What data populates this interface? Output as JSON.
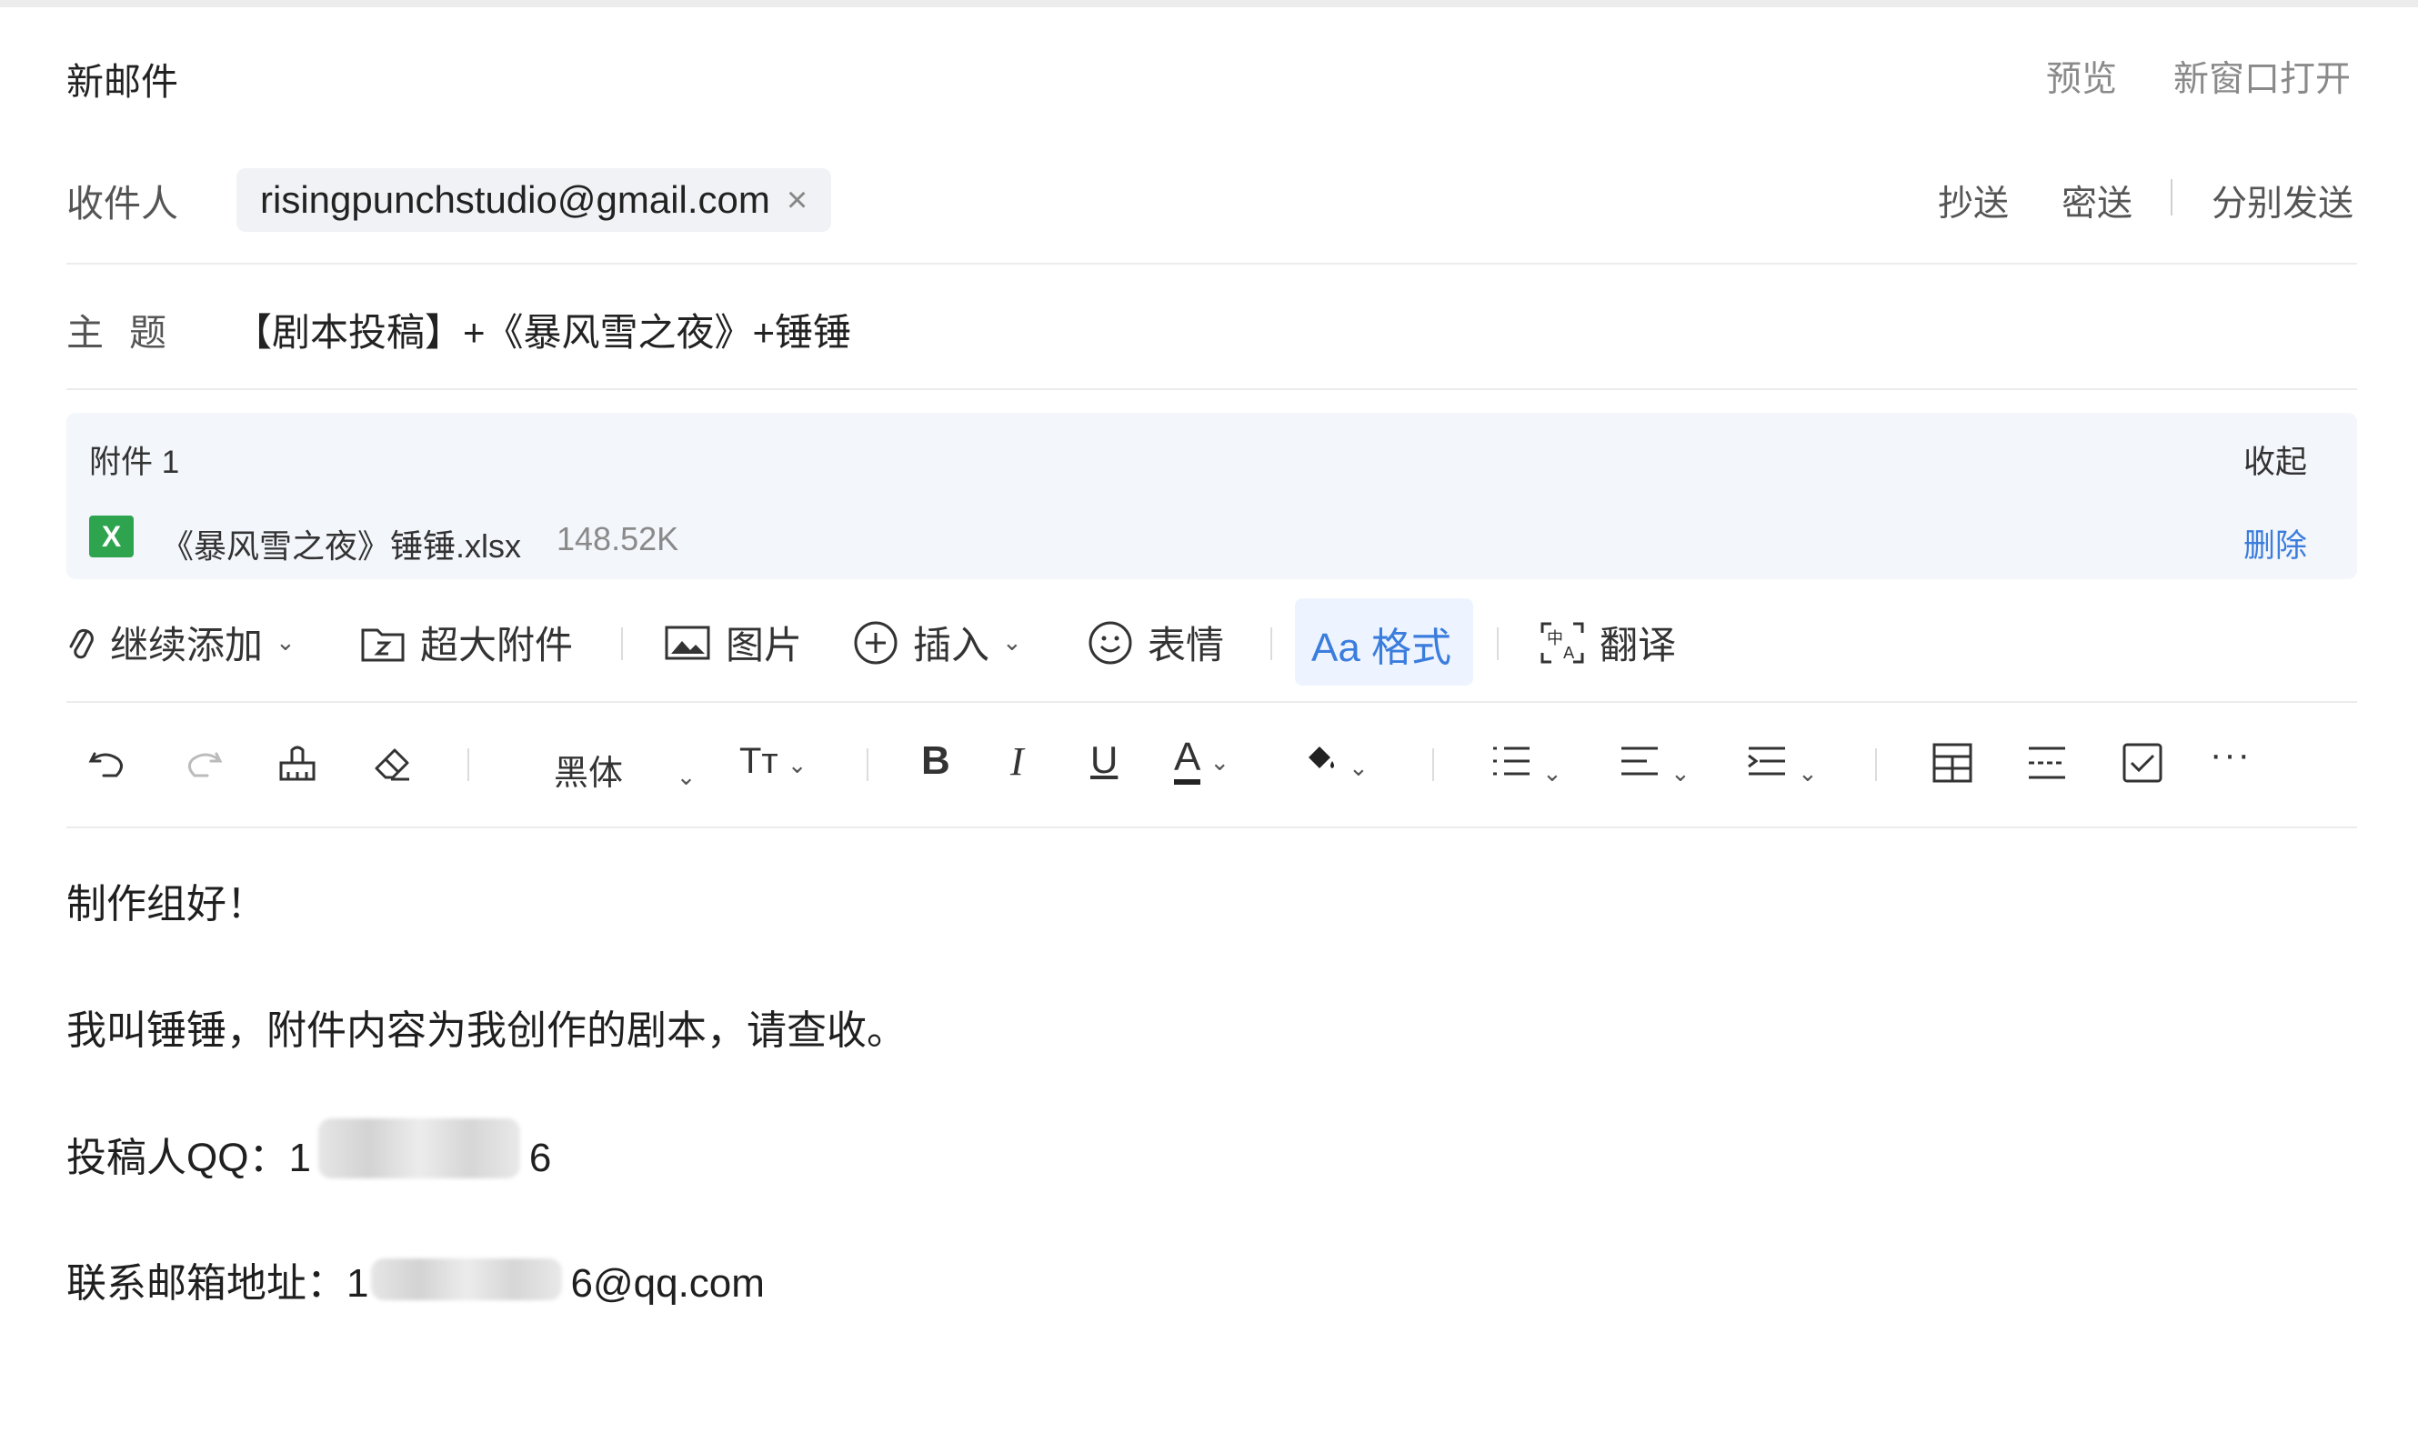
{
  "header": {
    "title": "新邮件",
    "preview": "预览",
    "new_window": "新窗口打开"
  },
  "recipients": {
    "label": "收件人",
    "to": "risingpunchstudio@gmail.com",
    "remove": "×",
    "cc": "抄送",
    "bcc": "密送",
    "split_send": "分别发送"
  },
  "subject": {
    "label": "主题",
    "value": "【剧本投稿】+《暴风雪之夜》+锤锤"
  },
  "attachments": {
    "header": "附件 1",
    "collapse": "收起",
    "items": [
      {
        "icon": "X",
        "name": "《暴风雪之夜》锤锤.xlsx",
        "size": "148.52K",
        "action": "删除"
      }
    ]
  },
  "attach_toolbar": {
    "add_more": "继续添加",
    "large_attachment": "超大附件",
    "image": "图片",
    "insert": "插入",
    "emoji": "表情",
    "format": "Aa 格式",
    "translate": "翻译"
  },
  "format_toolbar": {
    "font": "黑体",
    "icons": [
      "undo-icon",
      "redo-icon",
      "format-painter-icon",
      "eraser-icon",
      "font-size-icon",
      "bold-icon",
      "italic-icon",
      "underline-icon",
      "font-color-icon",
      "highlight-icon",
      "list-icon",
      "align-icon",
      "indent-icon",
      "table-icon",
      "divider-icon",
      "checkbox-icon",
      "more-icon"
    ]
  },
  "body": {
    "line1": "制作组好！",
    "line2": "我叫锤锤，附件内容为我创作的剧本，请查收。",
    "qq_label": "投稿人QQ：1",
    "qq_end": "6",
    "email_label": "联系邮箱地址：1",
    "email_end": "6@qq.com"
  },
  "colors": {
    "accent": "#3b7ddd",
    "excel": "#2ea44f",
    "attachment_bg": "#f3f6fb"
  }
}
